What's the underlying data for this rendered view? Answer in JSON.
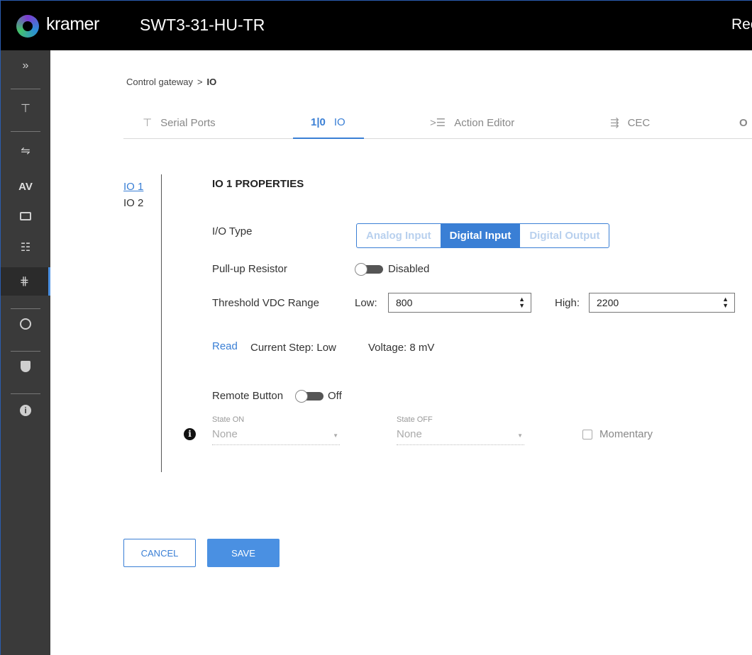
{
  "header": {
    "brand": "kramer",
    "device_name": "SWT3-31-HU-TR",
    "right_text": "Rec"
  },
  "sidebar": {
    "items": [
      {
        "icon": "expand-chevrons-icon",
        "glyph": "»"
      },
      {
        "icon": "routing-icon",
        "glyph": "⊤"
      },
      {
        "icon": "auto-switching-icon",
        "glyph": "⇋"
      },
      {
        "icon": "av-icon",
        "glyph": "AV"
      },
      {
        "icon": "edid-icon",
        "glyph": ""
      },
      {
        "icon": "settings-icon",
        "glyph": "☷"
      },
      {
        "icon": "control-gateway-icon",
        "glyph": "⋕"
      },
      {
        "icon": "diagnostics-icon",
        "glyph": ""
      },
      {
        "icon": "security-icon",
        "glyph": ""
      },
      {
        "icon": "info-icon",
        "glyph": "i"
      }
    ]
  },
  "breadcrumb": {
    "parent": "Control gateway",
    "separator": ">",
    "current": "IO"
  },
  "tabs": [
    {
      "label": "Serial Ports",
      "glyph": "⊤",
      "icon": "serial-ports-icon"
    },
    {
      "label": "IO",
      "glyph": "1|0",
      "icon": "io-icon"
    },
    {
      "label": "Action Editor",
      "glyph": ">☰",
      "icon": "action-editor-icon"
    },
    {
      "label": "CEC",
      "glyph": "⇶",
      "icon": "cec-icon"
    },
    {
      "label": "",
      "glyph": "O",
      "icon": "more-icon"
    }
  ],
  "io_list": [
    "IO 1",
    "IO 2"
  ],
  "properties": {
    "title": "IO 1 PROPERTIES",
    "io_type_label": "I/O Type",
    "io_type_options": [
      "Analog Input",
      "Digital Input",
      "Digital Output"
    ],
    "io_type_selected": "Digital Input",
    "pullup_label": "Pull-up Resistor",
    "pullup_state": "Disabled",
    "threshold_label": "Threshold VDC Range",
    "low_label": "Low:",
    "low_value": "800",
    "high_label": "High:",
    "high_value": "2200",
    "read_label": "Read",
    "current_step": "Current Step: Low",
    "voltage": "Voltage: 8 mV",
    "remote_label": "Remote Button",
    "remote_state": "Off",
    "state_on_label": "State ON",
    "state_on_value": "None",
    "state_off_label": "State OFF",
    "state_off_value": "None",
    "momentary_label": "Momentary",
    "info_glyph": "i"
  },
  "buttons": {
    "cancel": "CANCEL",
    "save": "SAVE"
  },
  "colors": {
    "accent": "#3a7fd5",
    "sidebar_bg": "#3a3a3a",
    "header_bg": "#000000"
  }
}
